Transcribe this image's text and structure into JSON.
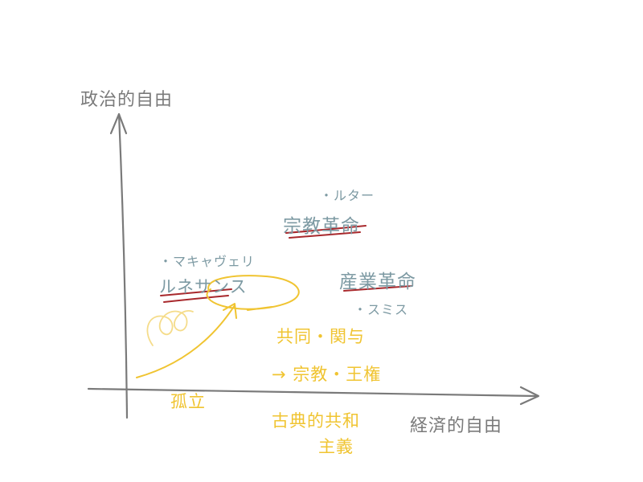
{
  "axes": {
    "y_label": "政治的自由",
    "x_label": "経済的自由"
  },
  "teal_labels": {
    "luther": "・ルター",
    "reformation": "宗教革命",
    "machiavelli": "・マキャヴェリ",
    "renaissance": "ルネサンス",
    "industrial_revolution": "産業革命",
    "smith": "・スミス"
  },
  "gold_labels": {
    "kyoudou_kanyo": "共同・関与",
    "shuukyou_ouken": "→ 宗教・王権",
    "koritsu": "孤立",
    "koten_kyouwa": "古典的共和",
    "shugi": "主義"
  },
  "colors": {
    "axis": "#7a7a7a",
    "teal": "#7d9aa3",
    "gold": "#f0c431",
    "underline": "#a8282c"
  }
}
